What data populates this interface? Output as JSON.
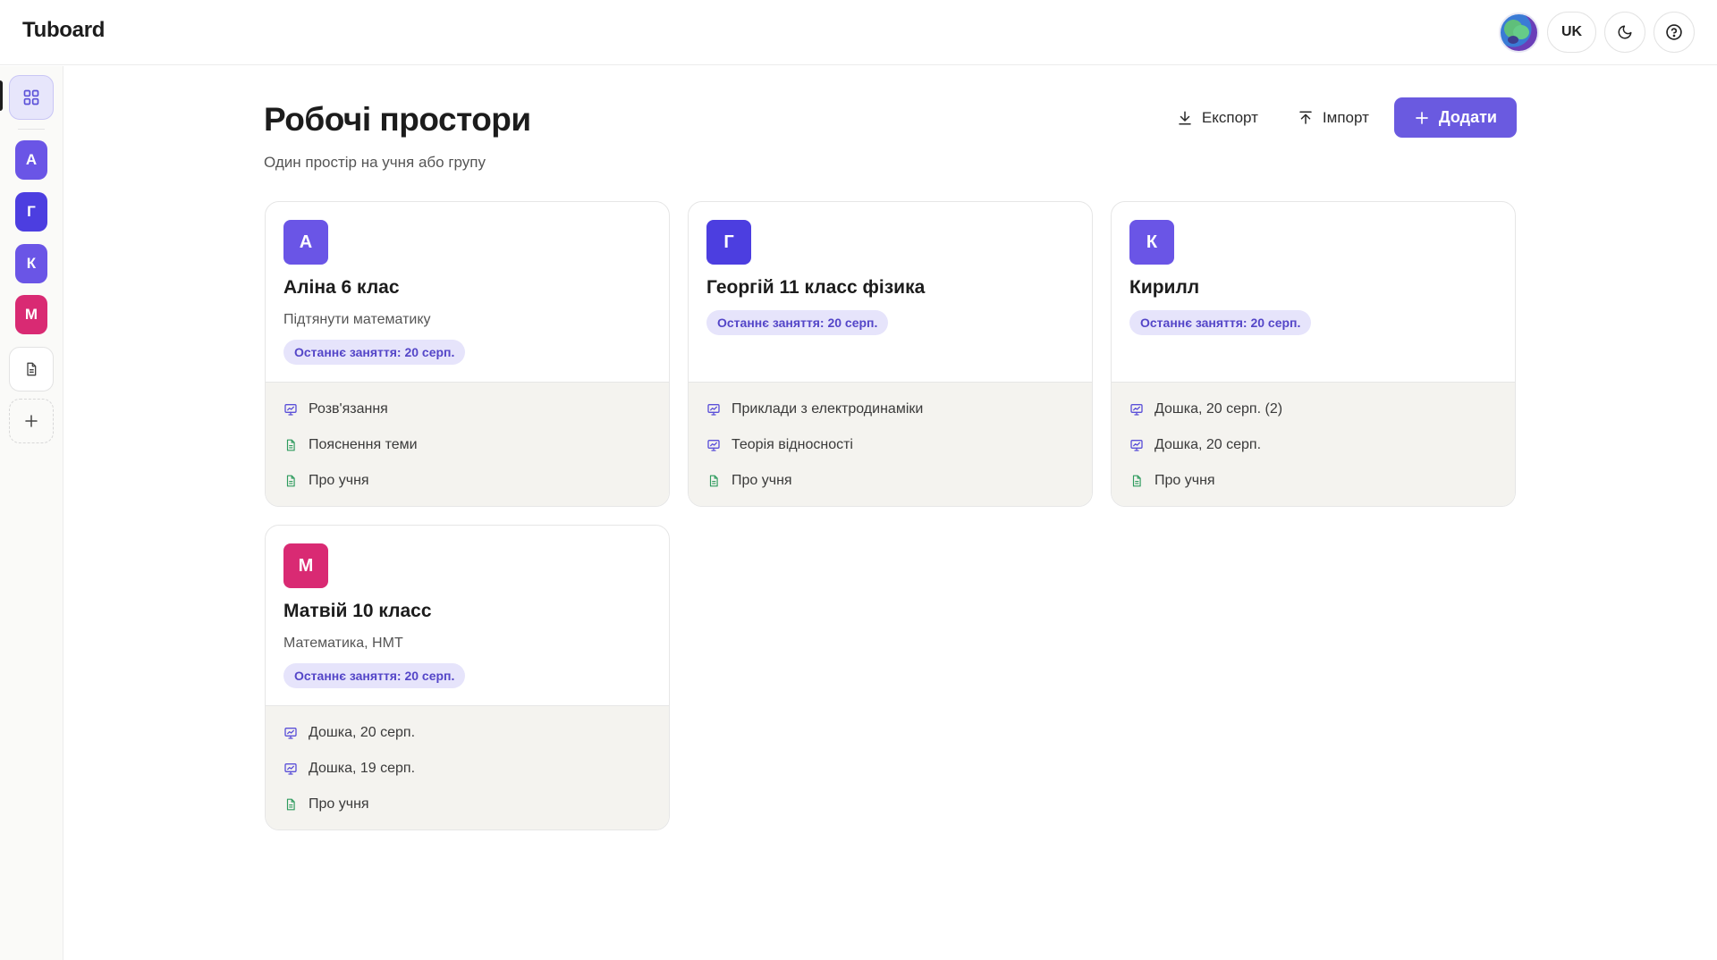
{
  "app": {
    "title": "Tuboard"
  },
  "topbar": {
    "lang_label": "UK"
  },
  "colors": {
    "accent": "#6a5ae0",
    "badge_bg": "#e6e4fb",
    "badge_text": "#5446c8",
    "board_icon": "#5b50d8",
    "doc_icon": "#2e9b5e"
  },
  "sidebar": {
    "items": [
      {
        "letter": "А",
        "color": "#6a55e6"
      },
      {
        "letter": "Г",
        "color": "#4c3ee0"
      },
      {
        "letter": "К",
        "color": "#6a55e6"
      },
      {
        "letter": "М",
        "color": "#d92a73"
      }
    ]
  },
  "main": {
    "title": "Робочі простори",
    "subtitle": "Один простір на учня або групу",
    "export_label": "Експорт",
    "import_label": "Імпорт",
    "add_label": "Додати"
  },
  "workspaces": [
    {
      "letter": "А",
      "color": "#6a55e6",
      "title": "Аліна 6 клас",
      "description": "Підтянути математику",
      "badge": "Останнє заняття: 20 серп.",
      "items": [
        {
          "type": "board",
          "label": "Розв'язання"
        },
        {
          "type": "doc",
          "label": "Пояснення теми"
        },
        {
          "type": "doc",
          "label": "Про учня"
        }
      ]
    },
    {
      "letter": "Г",
      "color": "#4c3ee0",
      "title": "Георгій 11 класс фізика",
      "description": "",
      "badge": "Останнє заняття: 20 серп.",
      "items": [
        {
          "type": "board",
          "label": "Приклади з електродинаміки"
        },
        {
          "type": "board",
          "label": "Теорія відносності"
        },
        {
          "type": "doc",
          "label": "Про учня"
        }
      ]
    },
    {
      "letter": "К",
      "color": "#6a55e6",
      "title": "Кирилл",
      "description": "",
      "badge": "Останнє заняття: 20 серп.",
      "items": [
        {
          "type": "board",
          "label": "Дошка, 20 серп. (2)"
        },
        {
          "type": "board",
          "label": "Дошка, 20 серп."
        },
        {
          "type": "doc",
          "label": "Про учня"
        }
      ]
    },
    {
      "letter": "М",
      "color": "#d92a73",
      "title": "Матвій 10 класс",
      "description": "Математика, НМТ",
      "badge": "Останнє заняття: 20 серп.",
      "items": [
        {
          "type": "board",
          "label": "Дошка, 20 серп."
        },
        {
          "type": "board",
          "label": "Дошка, 19 серп."
        },
        {
          "type": "doc",
          "label": "Про учня"
        }
      ]
    }
  ]
}
